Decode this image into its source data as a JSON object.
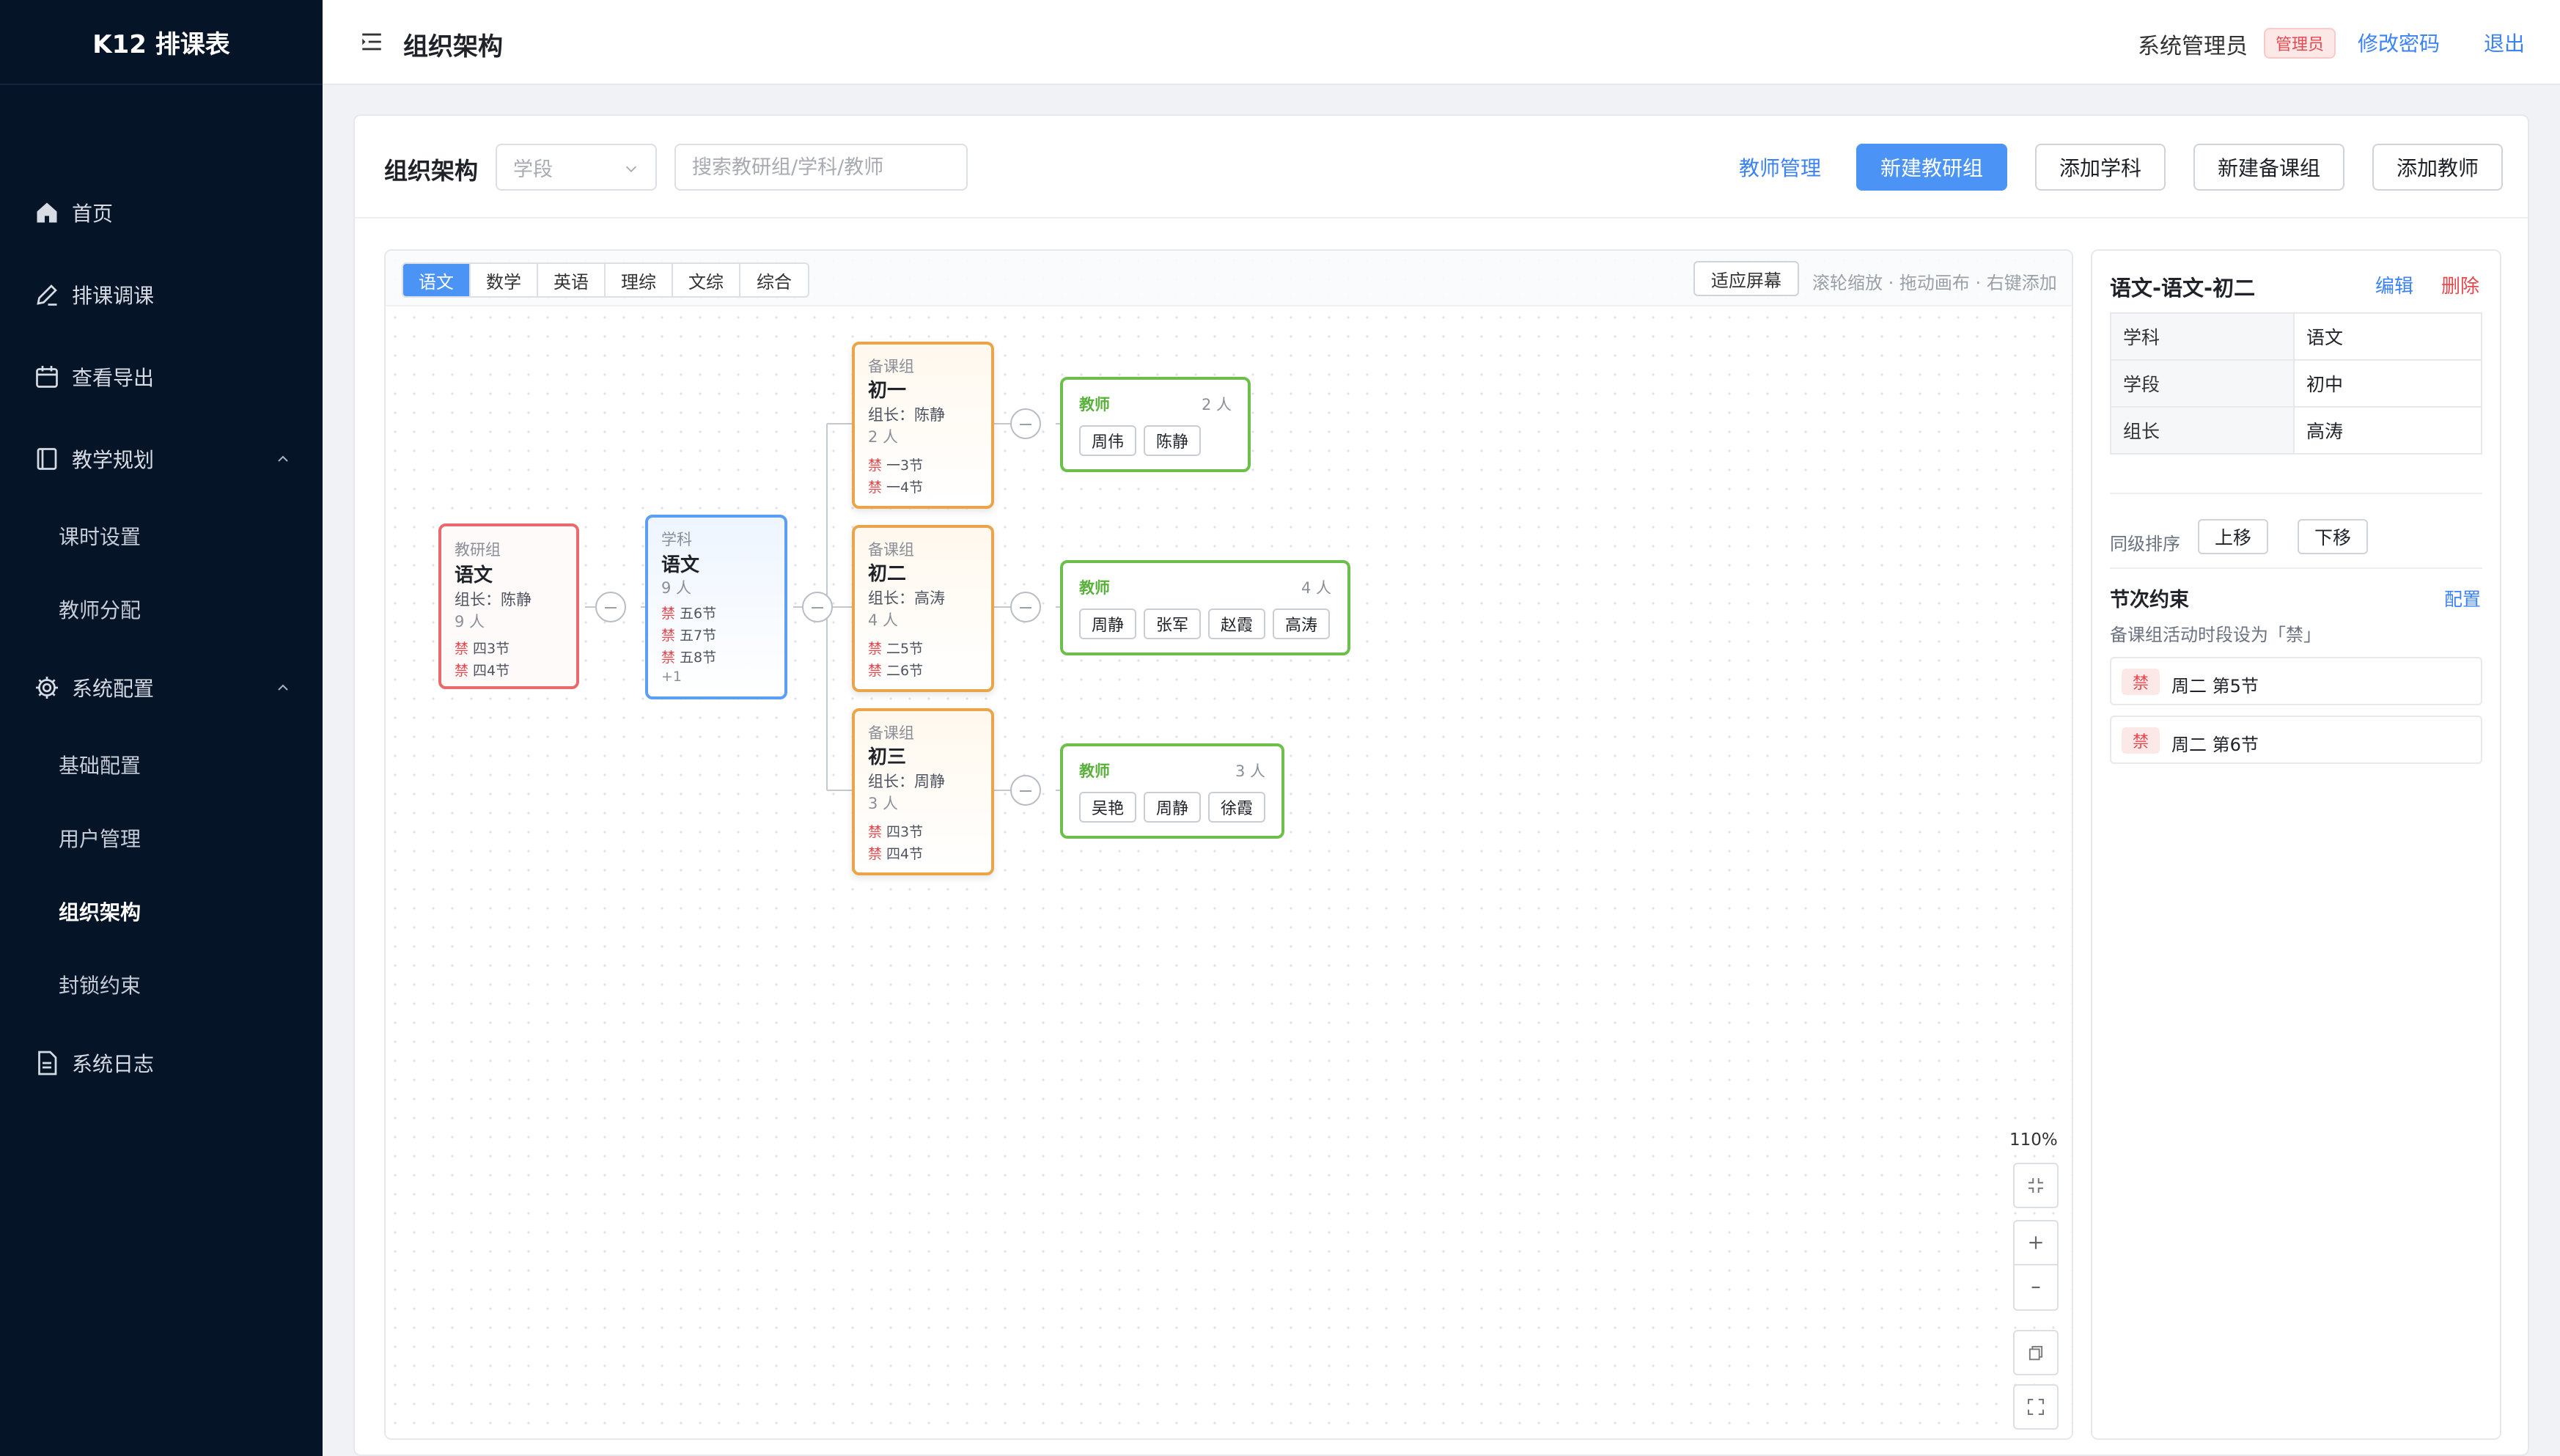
{
  "app": {
    "brand": "K12 排课表"
  },
  "sidebar": {
    "items": [
      {
        "label": "首页",
        "icon": "home-icon"
      },
      {
        "label": "排课调课",
        "icon": "pencil-icon"
      },
      {
        "label": "查看导出",
        "icon": "calendar-icon"
      },
      {
        "label": "教学规划",
        "icon": "book-icon",
        "children": [
          "课时设置",
          "教师分配"
        ]
      },
      {
        "label": "系统配置",
        "icon": "gear-icon",
        "children": [
          "基础配置",
          "用户管理",
          "组织架构",
          "封锁约束"
        ]
      },
      {
        "label": "系统日志",
        "icon": "document-icon"
      }
    ],
    "active": "组织架构"
  },
  "header": {
    "title": "组织架构",
    "user": "系统管理员",
    "role": "管理员",
    "change_password": "修改密码",
    "logout": "退出"
  },
  "toolbar": {
    "title": "组织架构",
    "stage_placeholder": "学段",
    "search_placeholder": "搜索教研组/学科/教师",
    "teacher_mgmt": "教师管理",
    "new_research_group": "新建教研组",
    "add_subject": "添加学科",
    "new_prep_group": "新建备课组",
    "add_teacher": "添加教师"
  },
  "canvas": {
    "tabs": [
      "语文",
      "数学",
      "英语",
      "理综",
      "文综",
      "综合"
    ],
    "active_tab": "语文",
    "fit_button": "适应屏幕",
    "hint": "滚轮缩放 · 拖动画布 · 右键添加",
    "zoom": "110%",
    "ban_mark": "禁",
    "tree": {
      "research_group": {
        "type": "教研组",
        "name": "语文",
        "leader": "组长：陈静",
        "count": "9 人",
        "constraints": [
          "四3节",
          "四4节"
        ]
      },
      "subject": {
        "type": "学科",
        "name": "语文",
        "count": "9 人",
        "constraints": [
          "五6节",
          "五7节",
          "五8节"
        ],
        "more": "+1"
      },
      "prep_groups": [
        {
          "type": "备课组",
          "name": "初一",
          "leader": "组长：陈静",
          "count": "2 人",
          "constraints": [
            "一3节",
            "一4节"
          ],
          "teachers": {
            "title": "教师",
            "count": "2 人",
            "names": [
              "周伟",
              "陈静"
            ]
          }
        },
        {
          "type": "备课组",
          "name": "初二",
          "leader": "组长：高涛",
          "count": "4 人",
          "constraints": [
            "二5节",
            "二6节"
          ],
          "teachers": {
            "title": "教师",
            "count": "4 人",
            "names": [
              "周静",
              "张军",
              "赵霞",
              "高涛"
            ]
          }
        },
        {
          "type": "备课组",
          "name": "初三",
          "leader": "组长：周静",
          "count": "3 人",
          "constraints": [
            "四3节",
            "四4节"
          ],
          "teachers": {
            "title": "教师",
            "count": "3 人",
            "names": [
              "吴艳",
              "周静",
              "徐霞"
            ]
          }
        }
      ]
    }
  },
  "panel": {
    "title": "语文-语文-初二",
    "edit": "编辑",
    "delete": "删除",
    "fields": [
      {
        "key": "学科",
        "value": "语文"
      },
      {
        "key": "学段",
        "value": "初中"
      },
      {
        "key": "组长",
        "value": "高涛"
      }
    ],
    "sort_label": "同级排序",
    "move_up": "上移",
    "move_down": "下移",
    "constraint_title": "节次约束",
    "constraint_config": "配置",
    "constraint_desc": "备课组活动时段设为「禁」",
    "constraint_tag": "禁",
    "constraints": [
      "周二 第5节",
      "周二 第6节"
    ]
  },
  "colors": {
    "sidebar_bg": "#061427",
    "primary": "#4b93f5",
    "danger": "#e5484d",
    "research_group_border": "#e86a6d",
    "subject_border": "#5b9ef5",
    "prep_group_border": "#eaa54a",
    "teacher_border": "#6cc04a"
  }
}
